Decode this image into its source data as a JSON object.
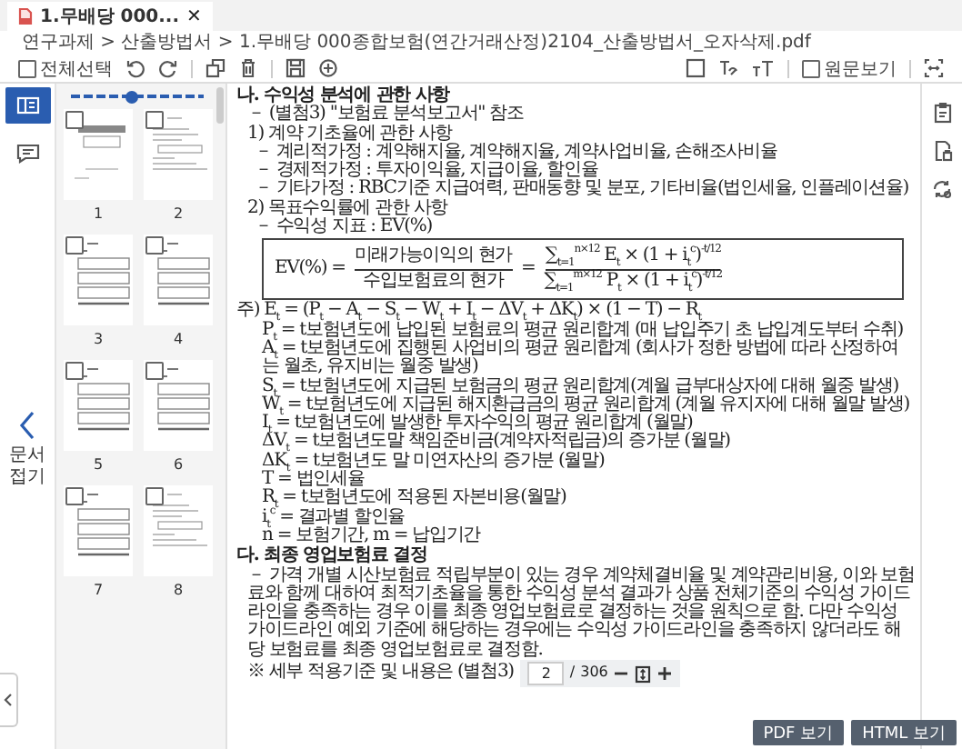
{
  "tab": {
    "label": "1.무배당 000...",
    "close": "✕"
  },
  "breadcrumb": "연구과제 > 산출방법서 > 1.무배당 000종합보험(연간거래산정)2104_산출방법서_오자삭제.pdf",
  "toolbar": {
    "select_all": {
      "label": "전체선택",
      "checked": false
    },
    "original_view": {
      "label": "원문보기",
      "checked": false
    }
  },
  "side_rail": {
    "tabs": [
      {
        "kind": "thumbnails",
        "selected": true
      },
      {
        "kind": "comments",
        "selected": false
      }
    ],
    "panel_toggle": {
      "label": "문서 접기"
    }
  },
  "thumbnails": {
    "zoom": {
      "level": 0.45
    },
    "pages": [
      {
        "number": "1",
        "kind": "cover",
        "checked": false
      },
      {
        "number": "2",
        "kind": "text",
        "checked": false
      },
      {
        "number": "3",
        "kind": "table",
        "checked": false
      },
      {
        "number": "4",
        "kind": "table",
        "checked": false
      },
      {
        "number": "5",
        "kind": "table",
        "checked": false
      },
      {
        "number": "6",
        "kind": "table",
        "checked": false
      },
      {
        "number": "7",
        "kind": "table",
        "checked": false
      },
      {
        "number": "8",
        "kind": "text",
        "checked": false
      }
    ]
  },
  "document": {
    "blocks": [
      {
        "kind": "heading",
        "text": "나. 수익성 분석에 관한 사항"
      },
      {
        "kind": "ref",
        "text": "－ (별첨3) \"보험료 분석보고서\" 참조"
      },
      {
        "kind": "subheading",
        "text": "1) 계약 기초율에 관한 사항"
      },
      {
        "kind": "bullet",
        "text": "－ 계리적가정 : 계약해지율, 계약해지율, 계약사업비율, 손해조사비율"
      },
      {
        "kind": "bullet",
        "text": "－ 경제적가정 : 투자이익율, 지급이율, 할인율"
      },
      {
        "kind": "bullet",
        "text": "－ 기타가정 : RBC기준 지급여력, 판매동향 및 분포, 기타비율(법인세율, 인플레이션율)"
      },
      {
        "kind": "subheading",
        "text": "2) 목표수익률에 관한 사항"
      },
      {
        "kind": "bullet",
        "text": "－ 수익성 지표 : EV(%)"
      },
      {
        "kind": "formula",
        "parts": [
          {
            "kind": "text",
            "text": "EV(%) ="
          },
          {
            "kind": "fraction",
            "numerator": "미래가능이익의 현가",
            "denominator": "수입보험료의 현가"
          },
          {
            "kind": "text",
            "text": "="
          },
          {
            "kind": "fraction",
            "numerator": "∑$_{t=1}$$^{n×12}$ E$_{t}$ × (1 + i$_{t}$$^{c}$)$^{-t/12}$",
            "denominator": "∑$_{t=1}$$^{m×12}$ P$_{t}$ × (1 + i$_{t}$$^{c}$)$^{-t/12}$"
          }
        ]
      },
      {
        "kind": "note",
        "text": "주) E$_{t}$ = (P$_{t}$ − A$_{t}$ − S$_{t}$ − W$_{t}$ + I$_{t}$ − ΔV$_{t}$ + ΔK$_{t}$) × (1 − T) − R$_{t}$"
      },
      {
        "kind": "definition",
        "text": "P$_{t}$ = t보험년도에 납입된 보험료의 평균 원리합계 (매 납입주기 초 납입계도부터 수취)"
      },
      {
        "kind": "definition",
        "text": "A$_{t}$ = t보험년도에 집행된 사업비의 평균 원리합계 (회사가 정한 방법에 따라 산정하여는 월초, 유지비는 월중 발생)"
      },
      {
        "kind": "definition",
        "text": "S$_{t}$ = t보험년도에 지급된 보험금의 평균 원리합계(계월 급부대상자에 대해 월중 발생)"
      },
      {
        "kind": "definition",
        "text": "W$_{t}$ = t보험년도에 지급된 해지환급금의 평균 원리합계 (계월 유지자에 대해 월말 발생)"
      },
      {
        "kind": "definition",
        "text": "I$_{t}$ = t보험년도에 발생한 투자수익의 평균 원리합계 (월말)"
      },
      {
        "kind": "definition",
        "text": "ΔV$_{t}$ = t보험년도말 책임준비금(계약자적립금)의 증가분 (월말)"
      },
      {
        "kind": "definition",
        "text": "ΔK$_{t}$ = t보험년도 말 미연자산의 증가분 (월말)"
      },
      {
        "kind": "definition",
        "text": "T = 법인세율"
      },
      {
        "kind": "definition",
        "text": "R$_{t}$ = t보험년도에 적용된 자본비용(월말)"
      },
      {
        "kind": "definition",
        "text": "i$_{t}$$^{c}$ = 결과별 할인율"
      },
      {
        "kind": "definition",
        "text": "n = 보험기간, m = 납입기간"
      },
      {
        "kind": "heading",
        "text": "다. 최종 영업보험료 결정"
      },
      {
        "kind": "paragraph",
        "text": "－ 가격 개별 시산보험료 적립부분이 있는 경우 계약체결비율 및 계약관리비용, 이와 보험료와 함께 대하여 최적기초율을 통한 수익성 분석 결과가 상품 전체기준의 수익성 가이드라인을 충족하는 경우 이를 최종 영업보험료로 결정하는 것을 원칙으로 함. 다만 수익성 가이드라인 예외 기준에 해당하는 경우에는 수익성 가이드라인을 충족하지 않더라도 해당 보험료를 최종 영업보험료로 결정함."
      },
      {
        "kind": "remark",
        "text": "※ 세부 적용기준 및 내용은 (별첨3)"
      }
    ]
  },
  "page_nav": {
    "current": "2",
    "separator": "/",
    "total": "306"
  },
  "buttons": [
    {
      "label": "PDF 보기"
    },
    {
      "label": "HTML 보기"
    }
  ]
}
